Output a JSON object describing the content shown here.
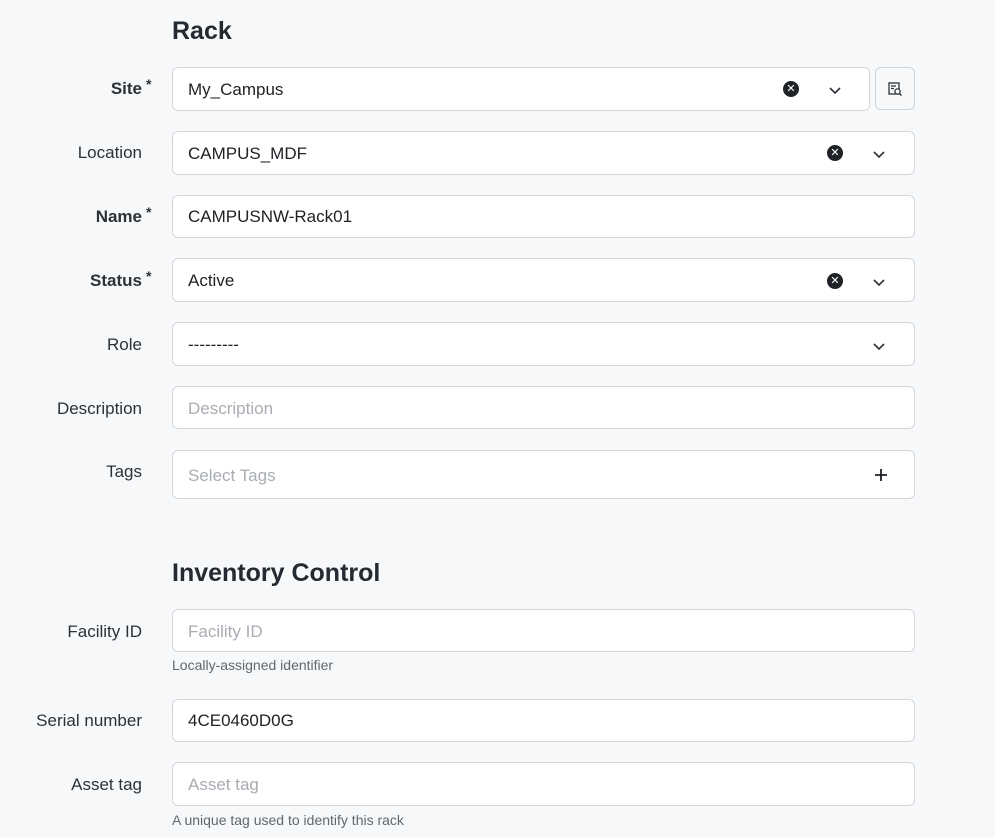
{
  "rack_section": {
    "title": "Rack"
  },
  "fields": {
    "site": {
      "label": "Site",
      "required": "*",
      "value": "My_Campus"
    },
    "location": {
      "label": "Location",
      "value": "CAMPUS_MDF"
    },
    "name": {
      "label": "Name",
      "required": "*",
      "value": "CAMPUSNW-Rack01"
    },
    "status": {
      "label": "Status",
      "required": "*",
      "value": "Active"
    },
    "role": {
      "label": "Role",
      "value": "---------"
    },
    "description": {
      "label": "Description",
      "placeholder": "Description",
      "value": ""
    },
    "tags": {
      "label": "Tags",
      "placeholder": "Select Tags"
    }
  },
  "inventory_section": {
    "title": "Inventory Control"
  },
  "inventory": {
    "facility_id": {
      "label": "Facility ID",
      "placeholder": "Facility ID",
      "help": "Locally-assigned identifier"
    },
    "serial_number": {
      "label": "Serial number",
      "value": "4CE0460D0G"
    },
    "asset_tag": {
      "label": "Asset tag",
      "placeholder": "Asset tag",
      "help": "A unique tag used to identify this rack"
    }
  },
  "icons": {
    "clear": "clear-icon",
    "chevron": "chevron-down-icon",
    "selector": "selector-search-icon",
    "add": "plus-icon"
  }
}
